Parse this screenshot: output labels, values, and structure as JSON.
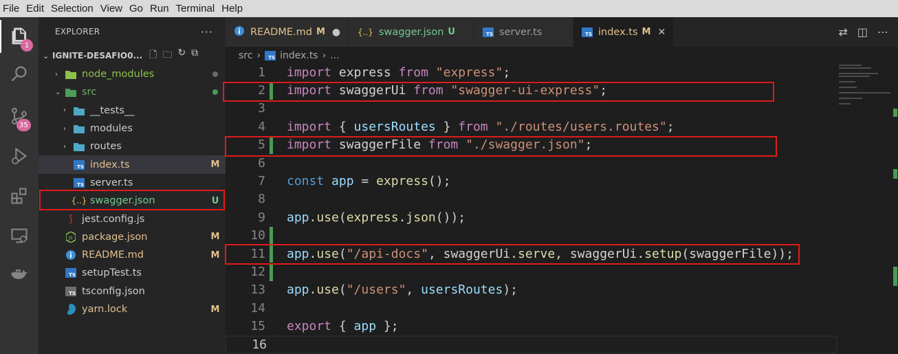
{
  "menu": [
    "File",
    "Edit",
    "Selection",
    "View",
    "Go",
    "Run",
    "Terminal",
    "Help"
  ],
  "activity": {
    "explorer_badge": "1",
    "scm_badge": "35"
  },
  "sidebar": {
    "title": "EXPLORER",
    "more": "···",
    "folder": "IGNITE-DESAFIO0...",
    "items": [
      {
        "label": "node_modules",
        "icon": "folder-node-icon",
        "color": "#8dc149",
        "status_dot": "#6b6b6b",
        "chevron": "›",
        "indent": 0
      },
      {
        "label": "src",
        "icon": "folder-src-icon",
        "color": "#6cb06a",
        "status_dot": "#4b9a55",
        "chevron": "⌄",
        "indent": 0
      },
      {
        "label": "__tests__",
        "icon": "folder-tests-icon",
        "color": "#cccccc",
        "chevron": "›",
        "indent": 1
      },
      {
        "label": "modules",
        "icon": "folder-modules-icon",
        "color": "#cccccc",
        "chevron": "›",
        "indent": 1
      },
      {
        "label": "routes",
        "icon": "folder-routes-icon",
        "color": "#cccccc",
        "chevron": "›",
        "indent": 1
      },
      {
        "label": "index.ts",
        "icon": "typescript-icon",
        "color": "#e2c08d",
        "status": "M",
        "indent": 1
      },
      {
        "label": "server.ts",
        "icon": "typescript-icon",
        "color": "#cccccc",
        "indent": 1
      },
      {
        "label": "swagger.json",
        "icon": "json-icon",
        "color": "#73c991",
        "status": "U",
        "indent": 1
      },
      {
        "label": "jest.config.js",
        "icon": "jest-icon",
        "color": "#cccccc",
        "indent": 0
      },
      {
        "label": "package.json",
        "icon": "nodejs-icon",
        "color": "#e2c08d",
        "status": "M",
        "indent": 0
      },
      {
        "label": "README.md",
        "icon": "info-icon",
        "color": "#e2c08d",
        "status": "M",
        "indent": 0
      },
      {
        "label": "setupTest.ts",
        "icon": "typescript-icon",
        "color": "#cccccc",
        "indent": 0
      },
      {
        "label": "tsconfig.json",
        "icon": "tsconfig-icon",
        "color": "#cccccc",
        "indent": 0
      },
      {
        "label": "yarn.lock",
        "icon": "yarn-icon",
        "color": "#e2c08d",
        "status": "M",
        "indent": 0
      }
    ]
  },
  "tabs": [
    {
      "label": "README.md",
      "status": "M",
      "tail": "●",
      "icon": "info-icon",
      "color": "#e2c08d"
    },
    {
      "label": "swagger.json",
      "status": "U",
      "icon": "json-icon",
      "color": "#73c991"
    },
    {
      "label": "server.ts",
      "icon": "typescript-icon",
      "color": "#9d9d9d"
    },
    {
      "label": "index.ts",
      "status": "M",
      "tail": "✕",
      "icon": "typescript-icon",
      "color": "#e2c08d",
      "active": true
    }
  ],
  "breadcrumb": {
    "folder": "src",
    "sep": "›",
    "file": "index.ts",
    "tail": "..."
  },
  "code": [
    {
      "n": "1",
      "tokens": [
        [
          "kw",
          "import"
        ],
        [
          "id",
          " express "
        ],
        [
          "kw",
          "from"
        ],
        [
          "id",
          " "
        ],
        [
          "str",
          "\"express\""
        ],
        [
          "id",
          ";"
        ]
      ]
    },
    {
      "n": "2",
      "mod": true,
      "tokens": [
        [
          "kw",
          "import"
        ],
        [
          "id",
          " swaggerUi "
        ],
        [
          "kw",
          "from"
        ],
        [
          "id",
          " "
        ],
        [
          "str",
          "\"swagger-ui-express\""
        ],
        [
          "id",
          ";"
        ]
      ]
    },
    {
      "n": "3",
      "tokens": []
    },
    {
      "n": "4",
      "tokens": [
        [
          "kw",
          "import"
        ],
        [
          "id",
          " { "
        ],
        [
          "var",
          "usersRoutes"
        ],
        [
          "id",
          " } "
        ],
        [
          "kw",
          "from"
        ],
        [
          "id",
          " "
        ],
        [
          "str",
          "\"./routes/users.routes\""
        ],
        [
          "id",
          ";"
        ]
      ]
    },
    {
      "n": "5",
      "mod": true,
      "tokens": [
        [
          "kw",
          "import"
        ],
        [
          "id",
          " swaggerFile "
        ],
        [
          "kw",
          "from"
        ],
        [
          "id",
          " "
        ],
        [
          "str",
          "\"./swagger.json\""
        ],
        [
          "id",
          ";"
        ]
      ]
    },
    {
      "n": "6",
      "tokens": []
    },
    {
      "n": "7",
      "tokens": [
        [
          "const",
          "const"
        ],
        [
          "id",
          " "
        ],
        [
          "var",
          "app"
        ],
        [
          "id",
          " = "
        ],
        [
          "fn",
          "express"
        ],
        [
          "id",
          "();"
        ]
      ]
    },
    {
      "n": "8",
      "tokens": []
    },
    {
      "n": "9",
      "tokens": [
        [
          "var",
          "app"
        ],
        [
          "id",
          "."
        ],
        [
          "fn",
          "use"
        ],
        [
          "id",
          "("
        ],
        [
          "fn",
          "express"
        ],
        [
          "id",
          "."
        ],
        [
          "fn",
          "json"
        ],
        [
          "id",
          "());"
        ]
      ]
    },
    {
      "n": "10",
      "mod": true,
      "tokens": []
    },
    {
      "n": "11",
      "mod": true,
      "tokens": [
        [
          "var",
          "app"
        ],
        [
          "id",
          "."
        ],
        [
          "fn",
          "use"
        ],
        [
          "id",
          "("
        ],
        [
          "str",
          "\"/api-docs\""
        ],
        [
          "id",
          ", swaggerUi."
        ],
        [
          "fn",
          "serve"
        ],
        [
          "id",
          ", swaggerUi."
        ],
        [
          "fn",
          "setup"
        ],
        [
          "id",
          "(swaggerFile));"
        ]
      ]
    },
    {
      "n": "12",
      "mod": true,
      "tokens": []
    },
    {
      "n": "13",
      "tokens": [
        [
          "var",
          "app"
        ],
        [
          "id",
          "."
        ],
        [
          "fn",
          "use"
        ],
        [
          "id",
          "("
        ],
        [
          "str",
          "\"/users\""
        ],
        [
          "id",
          ", "
        ],
        [
          "var",
          "usersRoutes"
        ],
        [
          "id",
          ");"
        ]
      ]
    },
    {
      "n": "14",
      "tokens": []
    },
    {
      "n": "15",
      "tokens": [
        [
          "kw",
          "export"
        ],
        [
          "id",
          " { "
        ],
        [
          "var",
          "app"
        ],
        [
          "id",
          " };"
        ]
      ]
    },
    {
      "n": "16",
      "tokens": [],
      "current": true
    }
  ],
  "colors": {
    "highlight": "#e01b1b",
    "modified": "#e2c08d",
    "untracked": "#73c991",
    "git_added": "#4b9a55"
  }
}
